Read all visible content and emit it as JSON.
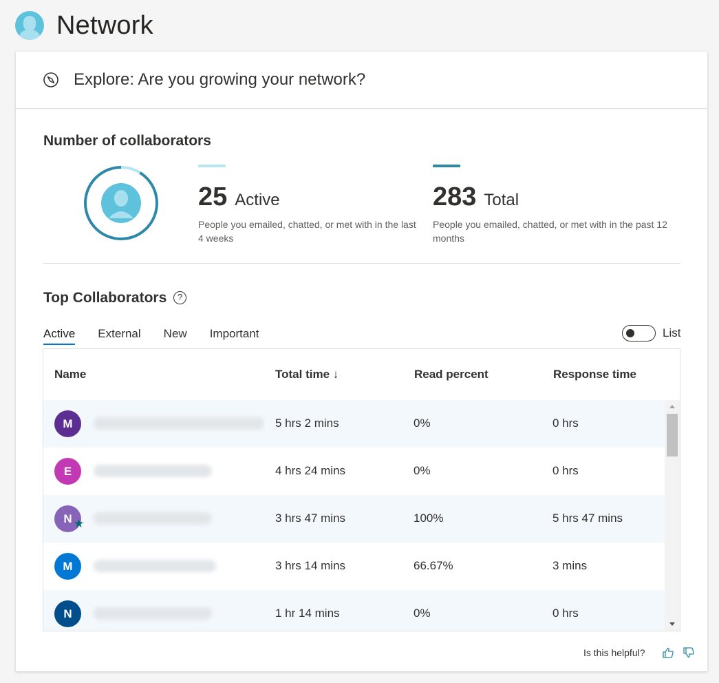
{
  "page": {
    "title": "Network"
  },
  "explore": {
    "text": "Explore: Are you growing your network?"
  },
  "collaborators": {
    "title": "Number of collaborators",
    "active": {
      "number": "25",
      "label": "Active",
      "description": "People you emailed, chatted, or met with in the last 4 weeks",
      "color": "#b9e4f1",
      "ratio": 0.0883
    },
    "total": {
      "number": "283",
      "label": "Total",
      "description": "People you emailed, chatted, or met with in the past 12 months",
      "color": "#2e88a7"
    }
  },
  "top_collaborators": {
    "title": "Top Collaborators",
    "help_icon": "question-circle-icon",
    "tabs": [
      {
        "label": "Active",
        "active": true
      },
      {
        "label": "External",
        "active": false
      },
      {
        "label": "New",
        "active": false
      },
      {
        "label": "Important",
        "active": false
      }
    ],
    "toggle_label": "List",
    "columns": {
      "name": "Name",
      "total_time": "Total time ↓",
      "read_percent": "Read percent",
      "response_time": "Response time"
    },
    "rows": [
      {
        "initial": "M",
        "avatar_color": "#5c2e91",
        "important": false,
        "total_time": "5 hrs 2 mins",
        "read_percent": "0%",
        "response_time": "0 hrs"
      },
      {
        "initial": "E",
        "avatar_color": "#c239b3",
        "important": false,
        "total_time": "4 hrs 24 mins",
        "read_percent": "0%",
        "response_time": "0 hrs"
      },
      {
        "initial": "N",
        "avatar_color": "#8764b8",
        "important": true,
        "total_time": "3 hrs 47 mins",
        "read_percent": "100%",
        "response_time": "5 hrs 47 mins"
      },
      {
        "initial": "M",
        "avatar_color": "#0078d4",
        "important": false,
        "total_time": "3 hrs 14 mins",
        "read_percent": "66.67%",
        "response_time": "3 mins"
      },
      {
        "initial": "N",
        "avatar_color": "#004e8c",
        "important": false,
        "total_time": "1 hr 14 mins",
        "read_percent": "0%",
        "response_time": "0 hrs"
      }
    ]
  },
  "feedback": {
    "text": "Is this helpful?",
    "like_icon": "thumbs-up-icon",
    "dislike_icon": "thumbs-down-icon"
  }
}
